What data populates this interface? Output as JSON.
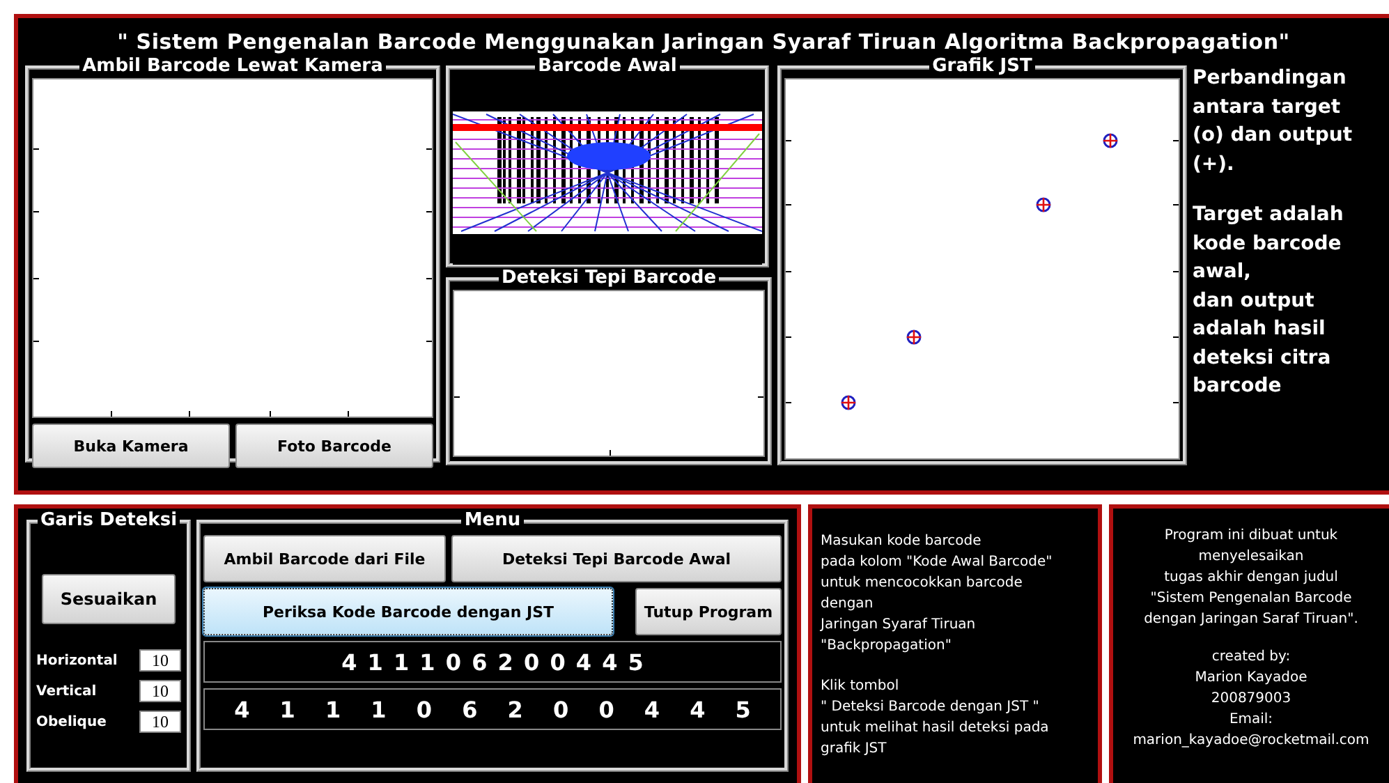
{
  "title": "\" Sistem Pengenalan Barcode Menggunakan Jaringan Syaraf Tiruan Algoritma Backpropagation\"",
  "camera_panel": {
    "title": "Ambil Barcode Lewat Kamera",
    "buttons": [
      "Buka Kamera",
      "Foto Barcode"
    ]
  },
  "original_barcode_panel": {
    "title": "Barcode Awal"
  },
  "edge_panel": {
    "title": "Deteksi Tepi Barcode"
  },
  "chart_panel": {
    "title": "Grafik JST"
  },
  "chart_note": [
    [
      "Perbandingan",
      "antara target",
      "(o) dan output",
      "(+)."
    ],
    [
      "Target adalah",
      "kode barcode",
      "awal,",
      "dan output",
      "adalah hasil",
      "deteksi citra",
      "barcode"
    ]
  ],
  "detection_lines": {
    "title": "Garis Deteksi",
    "button": "Sesuaikan",
    "fields": [
      {
        "label": "Horizontal",
        "value": "10"
      },
      {
        "label": "Vertical",
        "value": "10"
      },
      {
        "label": "Obelique",
        "value": "10"
      }
    ]
  },
  "menu": {
    "title": "Menu",
    "buttons": [
      {
        "label": "Ambil Barcode dari File",
        "selected": false
      },
      {
        "label": "Deteksi Tepi Barcode Awal",
        "selected": false
      },
      {
        "label": "Periksa Kode Barcode dengan JST",
        "selected": true
      },
      {
        "label": "Tutup Program",
        "selected": false
      }
    ],
    "code_displays": [
      "4 1 1 1 0 6 2 0 0 4 4 5",
      "4 1 1 1 0 6 2 0 0 4 4 5"
    ]
  },
  "instructions": [
    [
      "Masukan kode barcode",
      "pada kolom \"Kode Awal Barcode\"",
      "untuk mencocokkan barcode",
      "dengan",
      "Jaringan Syaraf Tiruan",
      "\"Backpropagation\""
    ],
    [
      "Klik tombol",
      "\" Deteksi Barcode dengan JST \"",
      "untuk melihat hasil deteksi pada",
      "grafik JST"
    ]
  ],
  "about": [
    [
      "Program ini dibuat untuk",
      "menyelesaikan",
      "tugas akhir dengan judul",
      "\"Sistem Pengenalan Barcode",
      "dengan Jaringan Saraf Tiruan\"."
    ],
    [
      "created by:",
      "Marion Kayadoe",
      "200879003",
      "Email:",
      "marion_kayadoe@rocketmail.com"
    ]
  ]
}
